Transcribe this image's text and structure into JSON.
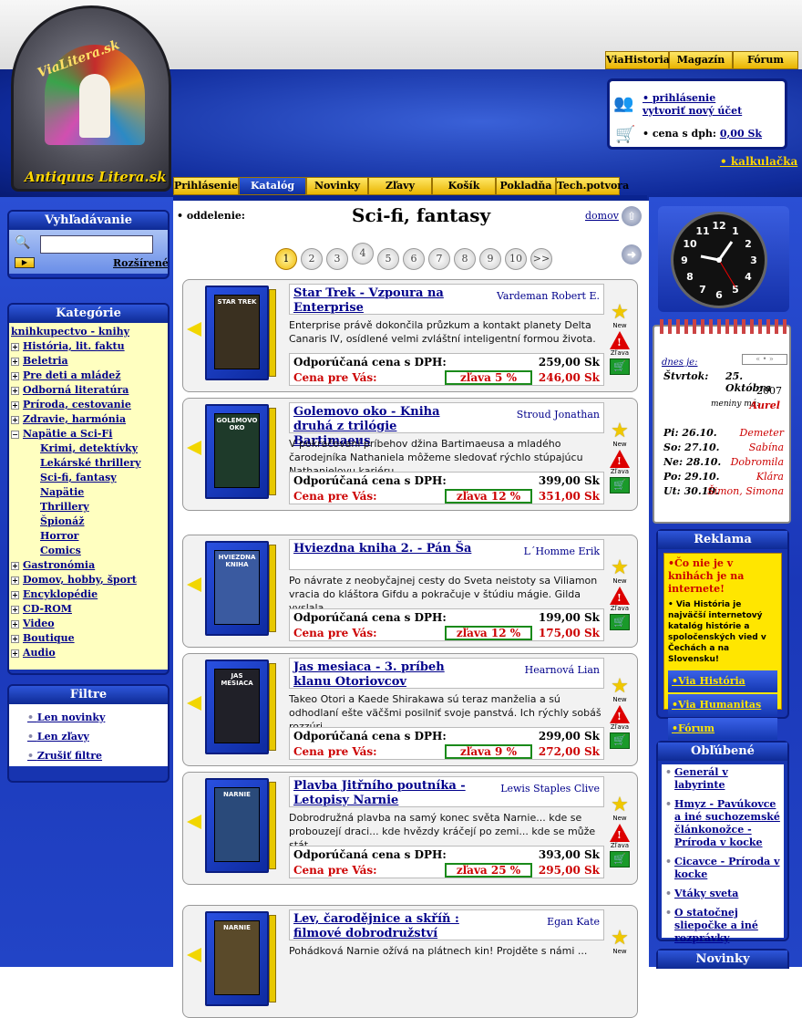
{
  "logo": {
    "top_text": "ViaLitera.sk",
    "bottom_text": "Antiquus Litera.sk"
  },
  "top_tabs": [
    "ViaHistoria",
    "Magazín",
    "Fórum"
  ],
  "login": {
    "signin": "• prihlásenie",
    "create": "vytvoriť nový účet",
    "price_label": "• cena s dph:",
    "price_value": "0,00 Sk"
  },
  "kalkulacka": "• kalkulačka",
  "nav_tabs": [
    "Prihlásenie",
    "Katalóg",
    "Novinky",
    "Zľavy",
    "Košík",
    "Pokladňa",
    "Tech.potvora"
  ],
  "search": {
    "title": "Vyhľadávanie",
    "advanced": "Rozšírené",
    "value": ""
  },
  "categories": {
    "title": "Kategórie",
    "root": "knihkupectvo - knihy",
    "items": [
      {
        "label": "História, lit. faktu",
        "box": "+"
      },
      {
        "label": "Beletria",
        "box": "+"
      },
      {
        "label": "Pre deti a mládež",
        "box": "+"
      },
      {
        "label": "Odborná literatúra",
        "box": "+"
      },
      {
        "label": "Príroda, cestovanie",
        "box": "+"
      },
      {
        "label": "Zdravie, harmónia",
        "box": "+"
      },
      {
        "label": "Napätie a Sci-Fi",
        "box": "−"
      }
    ],
    "sub": [
      "Krimi, detektívky",
      "Lekárské thrillery",
      "Sci-fi, fantasy",
      "Napätie",
      "Thrillery",
      "Špionáž",
      "Horror",
      "Comics"
    ],
    "items2": [
      "Gastronómia",
      "Domov, hobby, šport",
      "Encyklopédie",
      "CD-ROM",
      "Video",
      "Boutique",
      "Audio"
    ]
  },
  "filters": {
    "title": "Filtre",
    "items": [
      "Len novinky",
      "Len zľavy",
      "Zrušiť filtre"
    ]
  },
  "main": {
    "oddelenie": "• oddelenie:",
    "title": "Sci-fi, fantasy",
    "home": "domov",
    "pages": [
      "1",
      "2",
      "3",
      "4",
      "5",
      "6",
      "7",
      "8",
      "9",
      "10",
      ">>"
    ]
  },
  "labels": {
    "recommended": "Odporúčaná cena s DPH:",
    "your_price": "Cena pre Vás:",
    "new": "New",
    "discount_label": "Zľava"
  },
  "products": [
    {
      "title": "Star Trek - Vzpoura na Enterprise",
      "author": "Vardeman Robert E.",
      "desc": "Enterprise právě dokončila průzkum a kontakt planety Delta Canaris IV, osídlené velmi zvláštní inteligentní formou života. ...",
      "price": "259,00 Sk",
      "sale": "246,00 Sk",
      "discount": "zľava 5 %",
      "cover": "STAR TREK",
      "cover_color": "#3a3020"
    },
    {
      "title": "Golemovo oko - Kniha druhá z trilógie Bartimaeus",
      "author": "Stroud Jonathan",
      "desc": "V pokračovaní príbehov džina Bartimaeusa a mladého čarodejníka Nathaniela môžeme sledovať rýchlo stúpajúcu Nathanielovu kariéru. ...",
      "price": "399,00 Sk",
      "sale": "351,00 Sk",
      "discount": "zľava 12 %",
      "cover": "GOLEMOVO OKO",
      "cover_color": "#1e3a2a"
    },
    {
      "title": "Hviezdna kniha 2. - Pán Ša",
      "author": "L´Homme Erik",
      "desc": "Po návrate z neobyčajnej cesty do Sveta neistoty sa Viliamon vracia do kláštora Gifdu a pokračuje v štúdiu mágie. Gilda vyslala ...",
      "price": "199,00 Sk",
      "sale": "175,00 Sk",
      "discount": "zľava 12 %",
      "cover": "HVIEZDNA KNIHA",
      "cover_color": "#3a5aa0"
    },
    {
      "title": "Jas mesiaca - 3. príbeh klanu Otoriovcov",
      "author": "Hearnová Lian",
      "desc": "Takeo Otori a Kaede Shirakawa sú teraz manželia a sú odhodlaní ešte väčšmi posilniť svoje panstvá. Ich rýchly sobáš rozzúri ...",
      "price": "299,00 Sk",
      "sale": "272,00 Sk",
      "discount": "zľava 9 %",
      "cover": "JAS MESIACA",
      "cover_color": "#202028"
    },
    {
      "title": "Plavba Jitřního poutníka - Letopisy Narnie",
      "author": "Lewis Staples Clive",
      "desc": "Dobrodružná plavba na samý konec světa Narnie... kde se probouzejí draci... kde hvězdy kráčejí po zemi... kde se může stát ...",
      "price": "393,00 Sk",
      "sale": "295,00 Sk",
      "discount": "zľava 25 %",
      "cover": "NARNIE",
      "cover_color": "#2a4a7a"
    },
    {
      "title": "Lev, čarodějnice a skříň : filmové dobrodružství",
      "author": "Egan Kate",
      "desc": "Pohádková Narnie ožívá na plátnech kin! Projděte s námi ...",
      "price": "",
      "sale": "",
      "discount": "",
      "cover": "NARNIE",
      "cover_color": "#5a4a2a"
    }
  ],
  "calendar": {
    "dnes": "dnes je:",
    "day": "Štvrtok:",
    "date": "25. Októbra",
    "year": "2007",
    "meniny_label": "meniny má:",
    "meniny": "Aurel",
    "rows": [
      {
        "d": "Pi: 26.10.",
        "n": "Demeter"
      },
      {
        "d": "So: 27.10.",
        "n": "Sabína"
      },
      {
        "d": "Ne: 28.10.",
        "n": "Dobromila"
      },
      {
        "d": "Po: 29.10.",
        "n": "Klára"
      },
      {
        "d": "Ut: 30.10.",
        "n": "Šimon, Simona"
      }
    ],
    "nav": "« • »"
  },
  "ads": {
    "title": "Reklama",
    "headline": "•Čo nie je v knihách je na internete!",
    "text": "• Via História je najväčší internetový katalóg histórie a spoločenských vied v Čechách a na Slovensku!",
    "links": [
      "•Via História",
      "•Via Humanitas",
      "•Fórum"
    ]
  },
  "favorites": {
    "title": "Obľúbené",
    "items": [
      "Generál v labyrinte",
      "Hmyz - Pavúkovce a iné suchozemské článkonožce - Príroda v kocke",
      "Cicavce - Príroda v kocke",
      "Vtáky sveta",
      "O statočnej sliepočke a iné rozprávky"
    ]
  },
  "novinky_title": "Novinky",
  "colors": {
    "accent_yellow": "#e9b400",
    "nav_blue": "#1a37b8",
    "link": "#00008b",
    "sale_red": "#cc0000",
    "discount_green": "#1a8a1a"
  }
}
